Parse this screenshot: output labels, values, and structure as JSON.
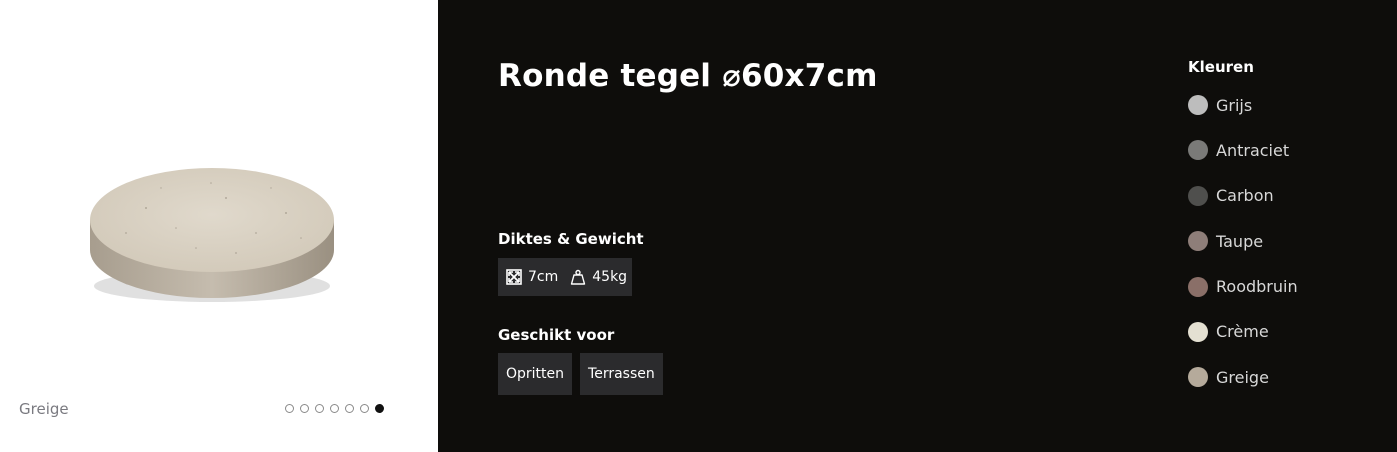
{
  "product": {
    "title": "Ronde tegel ⌀60x7cm",
    "image_icon": "round-concrete-tile",
    "selected_color": "Greige"
  },
  "gallery": {
    "dot_count": 7,
    "active_index": 6
  },
  "specs": {
    "heading": "Diktes & Gewicht",
    "thickness": "7cm",
    "thickness_icon": "dimensions-icon",
    "weight": "45kg",
    "weight_icon": "weight-icon"
  },
  "usage": {
    "heading": "Geschikt voor",
    "tags": [
      "Opritten",
      "Terrassen"
    ]
  },
  "colors": {
    "heading": "Kleuren",
    "items": [
      {
        "label": "Grijs",
        "hex": "#bdbdbd"
      },
      {
        "label": "Antraciet",
        "hex": "#7a7a78"
      },
      {
        "label": "Carbon",
        "hex": "#4f4f4d"
      },
      {
        "label": "Taupe",
        "hex": "#8e7e79"
      },
      {
        "label": "Roodbruin",
        "hex": "#8a6f68"
      },
      {
        "label": "Crème",
        "hex": "#e4e0d2"
      },
      {
        "label": "Greige",
        "hex": "#b5aa9b"
      }
    ]
  },
  "theme": {
    "panel_bg": "#0e0d0b",
    "chip_bg": "#2b2b2d"
  }
}
